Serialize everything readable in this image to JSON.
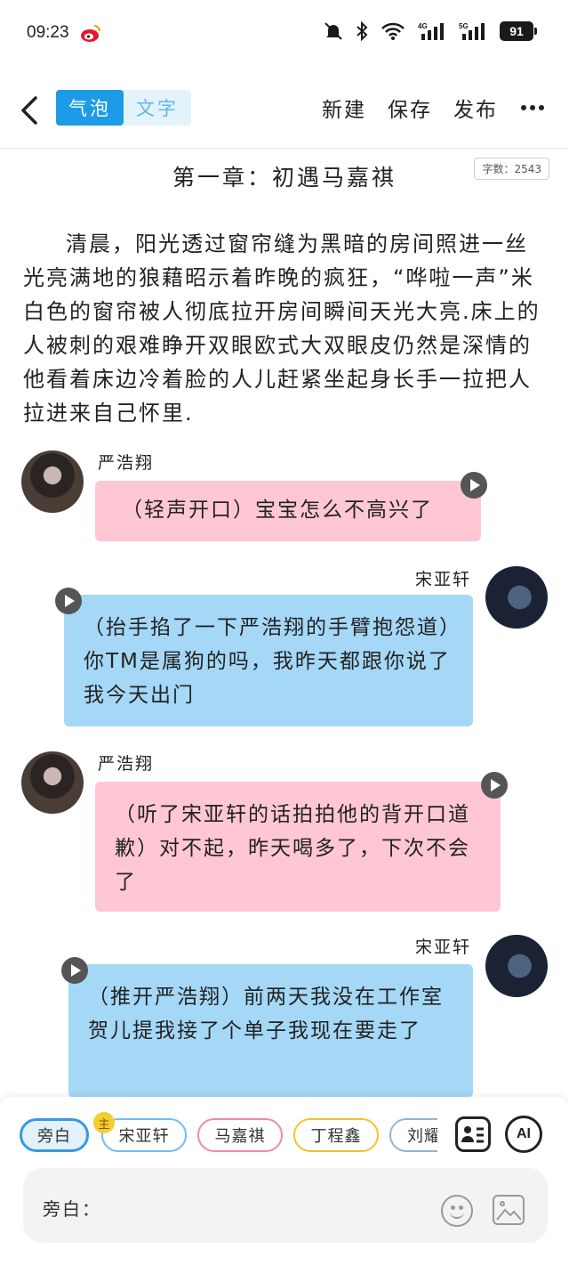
{
  "status_bar": {
    "time": "09:23",
    "battery": "91"
  },
  "toolbar": {
    "seg_bubble": "气泡",
    "seg_text": "文字",
    "new_label": "新建",
    "save_label": "保存",
    "publish_label": "发布"
  },
  "chapter": {
    "title": "第一章：初遇马嘉祺",
    "word_count": "字数：2543"
  },
  "narration": "清晨，阳光透过窗帘缝为黑暗的房间照进一丝光亮满地的狼藉昭示着昨晚的疯狂，“哗啦一声”米白色的窗帘被人彻底拉开房间瞬间天光大亮.床上的人被刺的艰难睁开双眼欧式大双眼皮仍然是深情的他看着床边冷着脸的人儿赶紧坐起身长手一拉把人拉进来自己怀里.",
  "messages": [
    {
      "speaker": "严浩翔",
      "text": "（轻声开口）宝宝怎么不高兴了"
    },
    {
      "speaker": "宋亚轩",
      "text": "（抬手掐了一下严浩翔的手臂抱怨道）你TM是属狗的吗，我昨天都跟你说了我今天出门"
    },
    {
      "speaker": "严浩翔",
      "text": "（听了宋亚轩的话拍拍他的背开口道歉）对不起，昨天喝多了，下次不会了"
    },
    {
      "speaker": "宋亚轩",
      "text": "（推开严浩翔）前两天我没在工作室贺儿提我接了个单子我现在要走了"
    }
  ],
  "characters": {
    "lead_badge": "主",
    "items": [
      {
        "label": "旁白",
        "color": "#3a97e0"
      },
      {
        "label": "宋亚轩",
        "color": "#6cc0ef"
      },
      {
        "label": "马嘉祺",
        "color": "#f08ca0"
      },
      {
        "label": "丁程鑫",
        "color": "#f2c230"
      },
      {
        "label": "刘耀文",
        "color": "#8fb5d6"
      }
    ]
  },
  "input": {
    "label": "旁白："
  },
  "ai_label": "AI",
  "colors": {
    "accent": "#1e9be6",
    "pink_bubble": "#ffc7d4",
    "blue_bubble": "#a5d8f7"
  }
}
